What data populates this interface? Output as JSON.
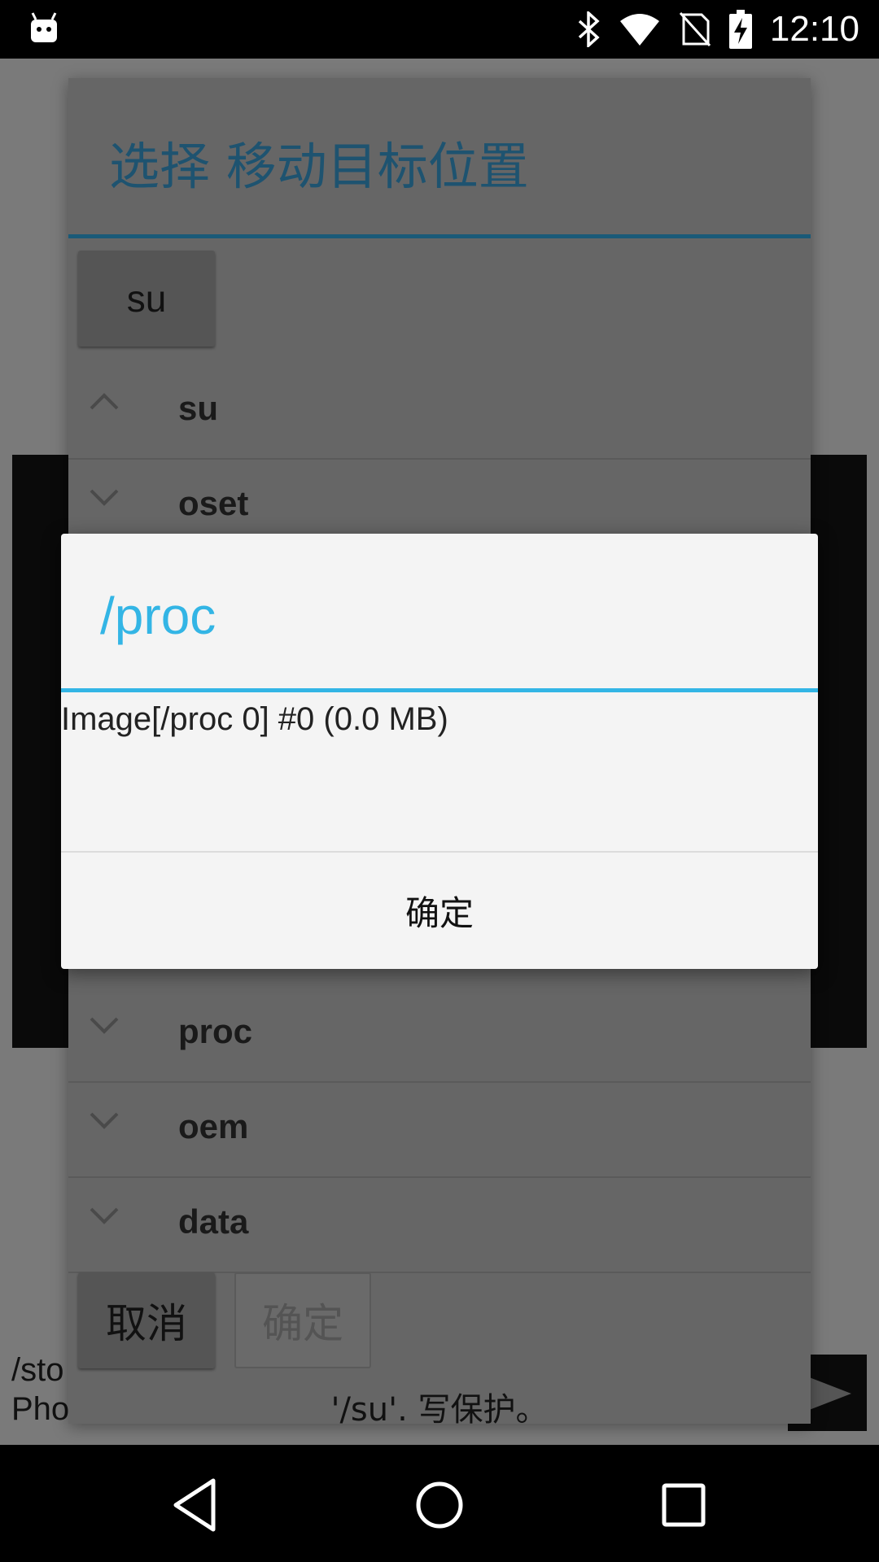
{
  "status_bar": {
    "time": "12:10",
    "icons": [
      "android-debug-icon",
      "bluetooth-icon",
      "wifi-icon",
      "no-sim-icon",
      "battery-charging-icon"
    ]
  },
  "picker": {
    "title": "选择 移动目标位置",
    "breadcrumb": "su",
    "rows": [
      {
        "name": "su",
        "expanded": true
      },
      {
        "name": "oset",
        "expanded": false
      },
      {
        "name": "proc",
        "expanded": false
      },
      {
        "name": "oem",
        "expanded": false
      },
      {
        "name": "data",
        "expanded": false
      }
    ],
    "cancel_label": "取消",
    "ok_label": "确定",
    "status": "'/su'. 写保护。"
  },
  "background": {
    "path_text": "/sto\nPho"
  },
  "dialog": {
    "title": "/proc",
    "message": "Image[/proc 0] #0 (0.0 MB)",
    "ok_label": "确定"
  },
  "colors": {
    "accent": "#33b5e5",
    "picker_title": "#1e5370"
  }
}
